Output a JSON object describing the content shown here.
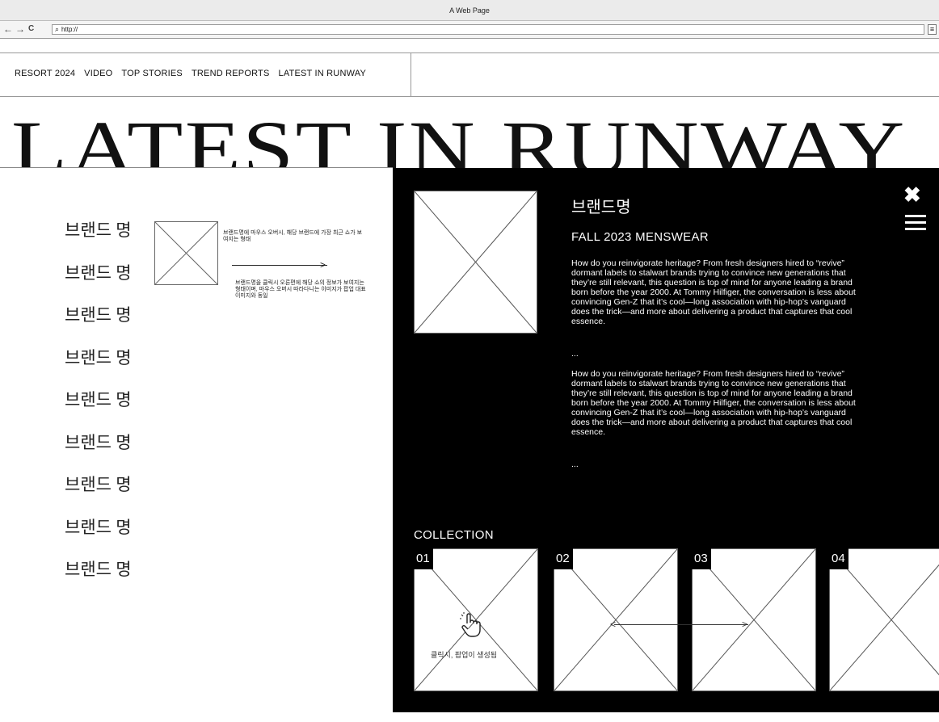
{
  "browser": {
    "window_title": "A Web Page",
    "url": "http://",
    "back_icon": "←",
    "forward_icon": "→",
    "reload_icon": "C",
    "menu_icon": "≡"
  },
  "nav": {
    "items": [
      "RESORT 2024",
      "VIDEO",
      "TOP STORIES",
      "TREND REPORTS",
      "LATEST IN RUNWAY"
    ]
  },
  "page_title": "LATEST IN RUNWAY",
  "brands": [
    "브랜드 명",
    "브랜드 명",
    "브랜드 명",
    "브랜드 명",
    "브랜드 명",
    "브랜드 명",
    "브랜드 명",
    "브랜드 명",
    "브랜드 명"
  ],
  "notes": {
    "hover": "브랜드명에 마우스 오버시, 해당 브랜드에 가장 최근 쇼가 보여지는 형태",
    "click": "브랜드명을 클릭시 오른편에 해당 쇼의 정보가 보여지는 형태이며, 마우스 오버시 따라다니는 이미지가 팝업 대표 이미지와 동일",
    "popup": "클릭시, 팝업이 생성됨"
  },
  "panel": {
    "brand": "브랜드명",
    "season": "FALL 2023 MENSWEAR",
    "paragraphs": [
      "How do you reinvigorate heritage? From fresh designers hired to “revive” dormant labels to stalwart brands trying to convince new generations that they’re still relevant, this question is top of mind for anyone leading a brand born before the year 2000. At Tommy Hilfiger, the conversation is less about convincing Gen-Z that it’s cool—long association with hip-hop’s vanguard does the trick—and more about delivering a product that captures that cool essence.",
      "...",
      "How do you reinvigorate heritage? From fresh designers hired to “revive” dormant labels to stalwart brands trying to convince new generations that they’re still relevant, this question is top of mind for anyone leading a brand born before the year 2000. At Tommy Hilfiger, the conversation is less about convincing Gen-Z that it’s cool—long association with hip-hop’s vanguard does the trick—and more about delivering a product that captures that cool essence.",
      "..."
    ],
    "close_icon": "✖",
    "collection_label": "COLLECTION",
    "collection": [
      "01",
      "02",
      "03",
      "04"
    ]
  }
}
